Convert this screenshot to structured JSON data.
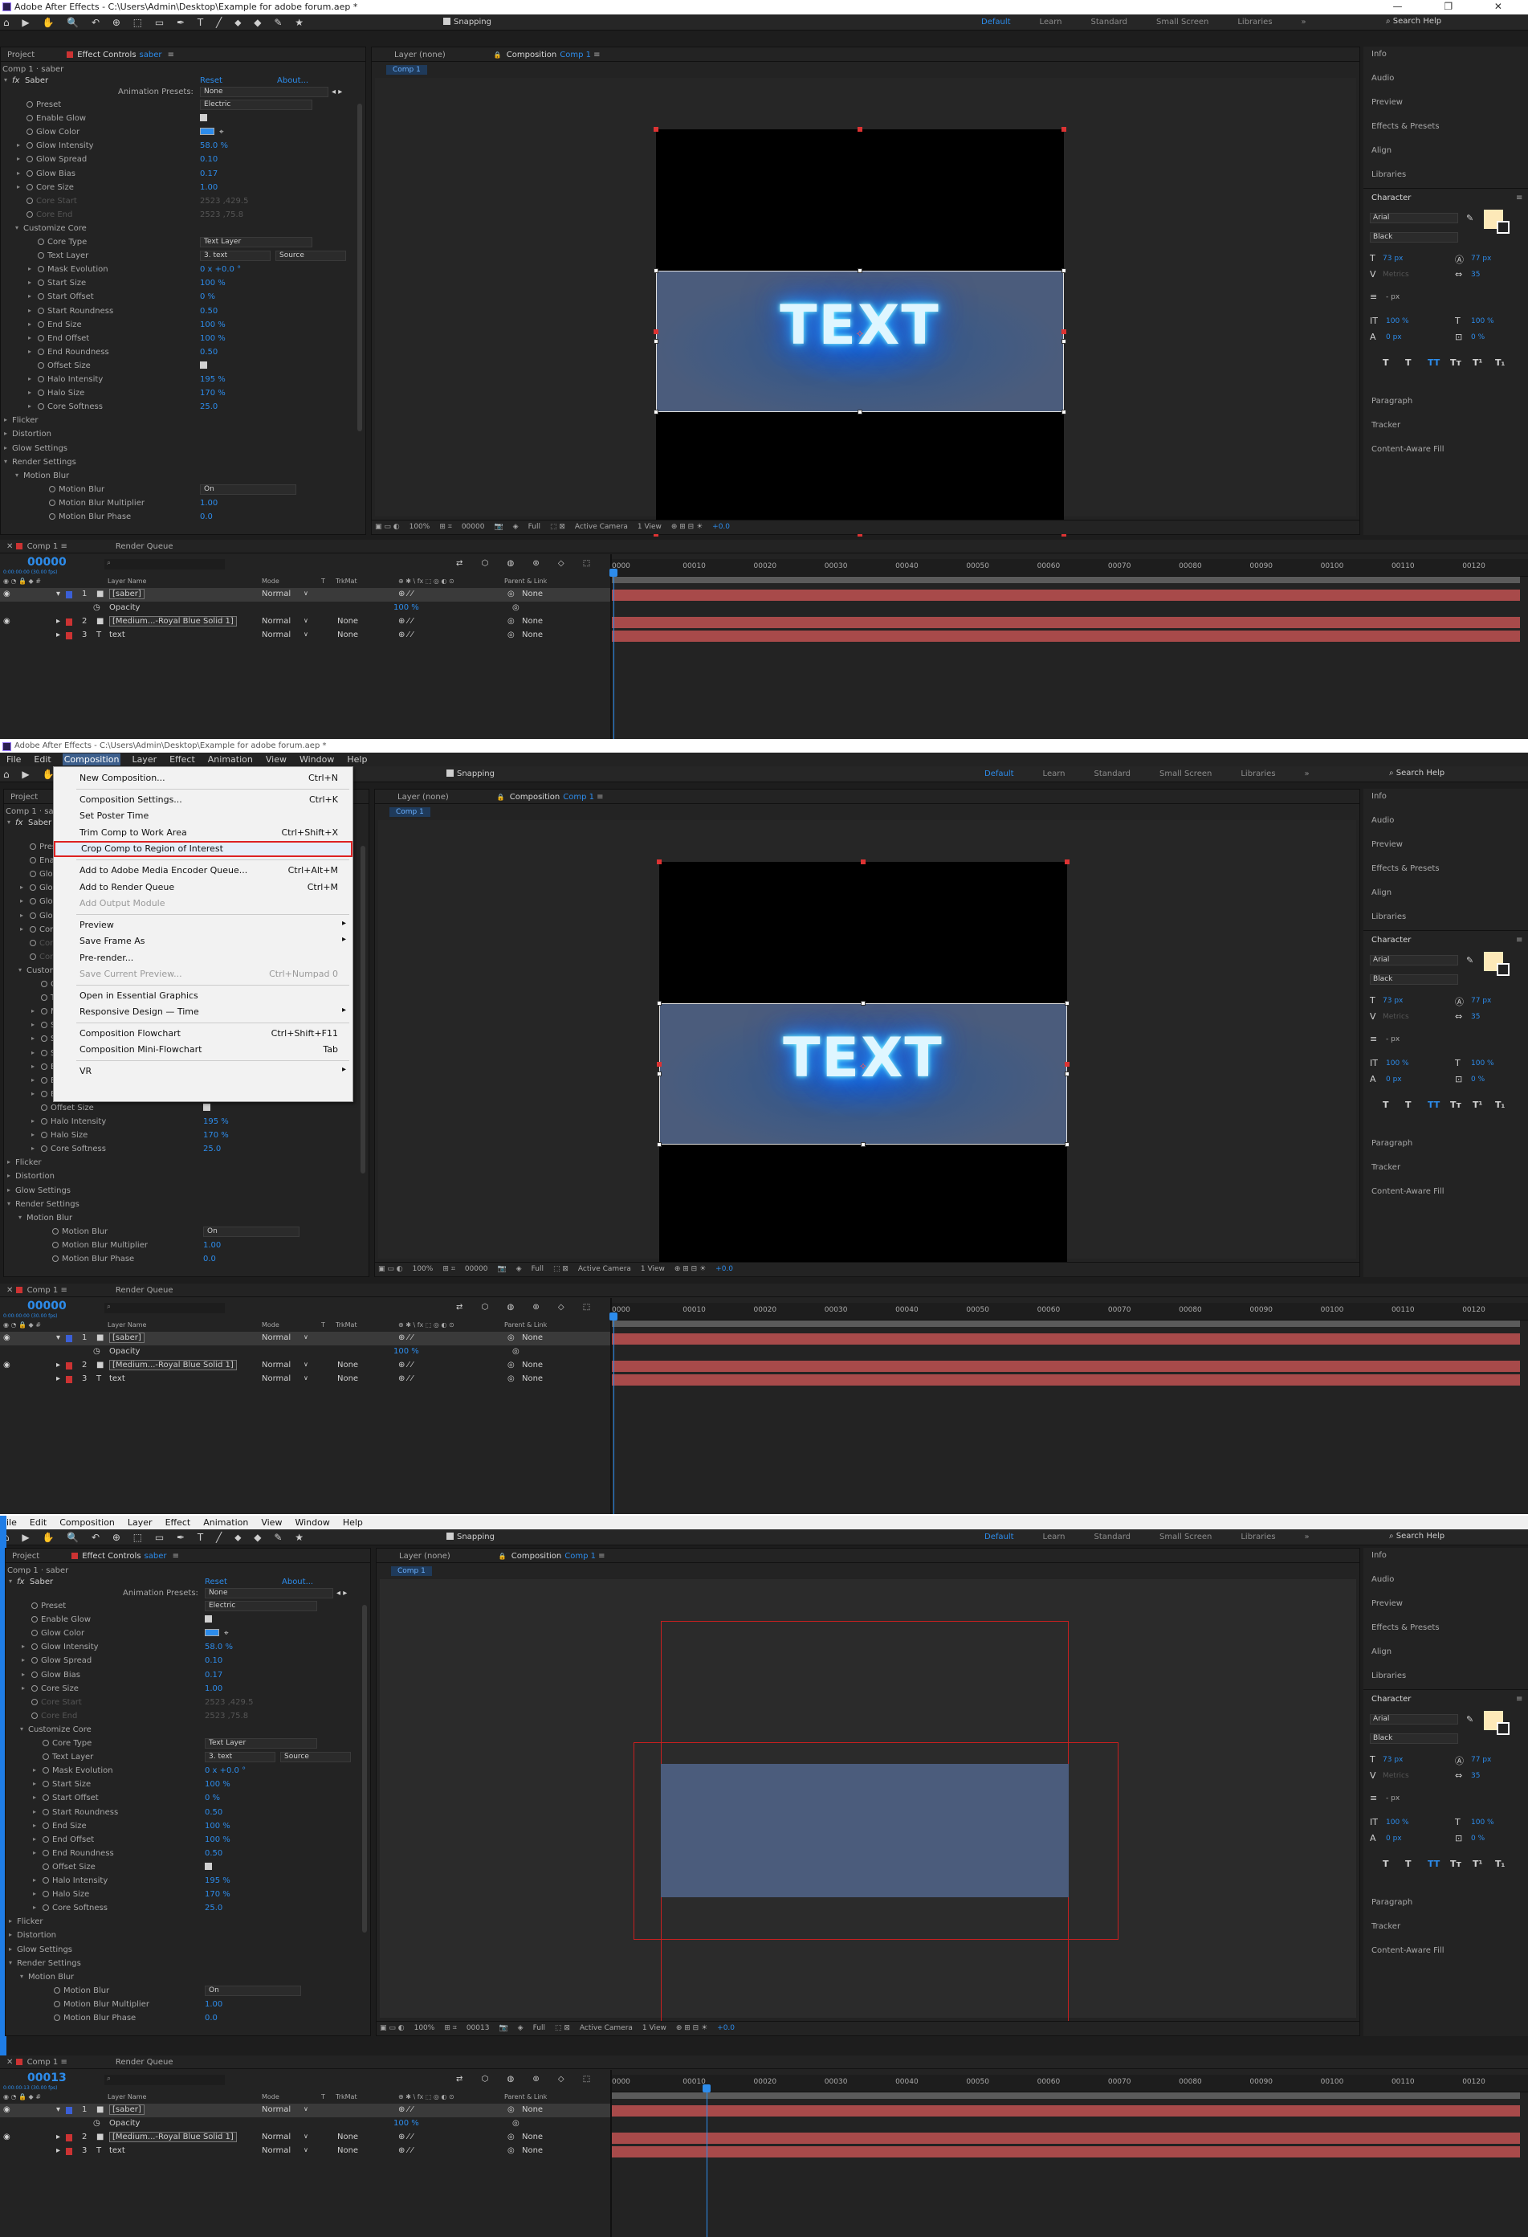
{
  "titlebar": {
    "title": "Adobe After Effects - C:\\Users\\Admin\\Desktop\\Example for adobe forum.aep *",
    "controls": "—  ❐  ✕"
  },
  "menus": [
    "File",
    "Edit",
    "Composition",
    "Layer",
    "Effect",
    "Animation",
    "View",
    "Window",
    "Help"
  ],
  "menus3": [
    "ile",
    "Edit",
    "Composition",
    "Layer",
    "Effect",
    "Animation",
    "View",
    "Window",
    "Help"
  ],
  "toolbar": {
    "tools": "⌂ ▶ ✋ 🔍 ↶ ⊕ ⬚ ▭ ✒ T ╱ ⬥ ◆ ✎ ★",
    "snapping": "Snapping",
    "search_placeholder": "Search Help"
  },
  "workspaces": [
    "Default",
    "Learn",
    "Standard",
    "Small Screen",
    "Libraries"
  ],
  "project_tab": "Project",
  "effect_controls": {
    "tab_prefix": "Effect Controls",
    "layer": "saber",
    "comp_layer": "Comp 1 · saber",
    "fx_name": "Saber",
    "reset": "Reset",
    "about": "About...",
    "presets_label": "Animation Presets:",
    "presets_value": "None"
  },
  "effect_rows": [
    {
      "label": "Preset",
      "kind": "dd",
      "value": "Electric",
      "indent": 1
    },
    {
      "label": "Enable Glow",
      "kind": "cb",
      "indent": 1
    },
    {
      "label": "Glow Color",
      "kind": "sw",
      "indent": 1
    },
    {
      "label": "Glow Intensity",
      "kind": "val",
      "value": "58.0 %",
      "indent": 1,
      "tri": true
    },
    {
      "label": "Glow Spread",
      "kind": "val",
      "value": "0.10",
      "indent": 1,
      "tri": true
    },
    {
      "label": "Glow Bias",
      "kind": "val",
      "value": "0.17",
      "indent": 1,
      "tri": true
    },
    {
      "label": "Core Size",
      "kind": "val",
      "value": "1.00",
      "indent": 1,
      "tri": true
    },
    {
      "label": "Core Start",
      "kind": "val",
      "value": "2523 ,429.5",
      "indent": 1,
      "dim": true
    },
    {
      "label": "Core End",
      "kind": "val",
      "value": "2523 ,75.8",
      "indent": 1,
      "dim": true
    },
    {
      "label": "Customize Core",
      "kind": "group",
      "indent": 1
    },
    {
      "label": "Core Type",
      "kind": "dd",
      "value": "Text Layer",
      "indent": 2
    },
    {
      "label": "Text Layer",
      "kind": "dd2",
      "value": "3. text",
      "value2": "Source",
      "indent": 2
    },
    {
      "label": "Mask Evolution",
      "kind": "val",
      "value": "0 x +0.0 °",
      "indent": 2,
      "tri": true
    },
    {
      "label": "Start Size",
      "kind": "val",
      "value": "100 %",
      "indent": 2,
      "tri": true
    },
    {
      "label": "Start Offset",
      "kind": "val",
      "value": "0 %",
      "indent": 2,
      "tri": true
    },
    {
      "label": "Start Roundness",
      "kind": "val",
      "value": "0.50",
      "indent": 2,
      "tri": true
    },
    {
      "label": "End Size",
      "kind": "val",
      "value": "100 %",
      "indent": 2,
      "tri": true
    },
    {
      "label": "End Offset",
      "kind": "val",
      "value": "100 %",
      "indent": 2,
      "tri": true
    },
    {
      "label": "End Roundness",
      "kind": "val",
      "value": "0.50",
      "indent": 2,
      "tri": true
    },
    {
      "label": "Offset Size",
      "kind": "cb",
      "indent": 2
    },
    {
      "label": "Halo Intensity",
      "kind": "val",
      "value": "195 %",
      "indent": 2,
      "tri": true
    },
    {
      "label": "Halo Size",
      "kind": "val",
      "value": "170 %",
      "indent": 2,
      "tri": true
    },
    {
      "label": "Core Softness",
      "kind": "val",
      "value": "25.0",
      "indent": 2,
      "tri": true
    },
    {
      "label": "Flicker",
      "kind": "group",
      "indent": 0
    },
    {
      "label": "Distortion",
      "kind": "group",
      "indent": 0
    },
    {
      "label": "Glow Settings",
      "kind": "group",
      "indent": 0
    },
    {
      "label": "Render Settings",
      "kind": "group",
      "indent": 0
    },
    {
      "label": "Motion Blur",
      "kind": "group",
      "indent": 1
    },
    {
      "label": "Motion Blur",
      "kind": "dd",
      "value": "On",
      "indent": 3
    },
    {
      "label": "Motion Blur Multiplier",
      "kind": "val",
      "value": "1.00",
      "indent": 3
    },
    {
      "label": "Motion Blur Phase",
      "kind": "val",
      "value": "0.0",
      "indent": 3
    }
  ],
  "comp_panel": {
    "layer_tab": "Layer (none)",
    "comp_tab_prefix": "Composition",
    "comp_name": "Comp 1",
    "crumb": "Comp 1",
    "glow_text": "TEXT"
  },
  "viewer_bar": {
    "zoom": "100%",
    "time1": "00000",
    "time3": "00013",
    "res": "Full",
    "camera": "Active Camera",
    "views": "1 View",
    "exposure": "+0.0"
  },
  "right_panels": [
    "Info",
    "Audio",
    "Preview",
    "Effects & Presets",
    "Align",
    "Libraries"
  ],
  "right_panels2": [
    "Paragraph",
    "Tracker",
    "Content-Aware Fill"
  ],
  "character": {
    "title": "Character",
    "font": "Arial",
    "style": "Black",
    "size": "73 px",
    "leading": "77 px",
    "kerning": "Metrics",
    "tracking": "35",
    "stroke": "- px",
    "vscale": "100 %",
    "hscale": "100 %",
    "baseline": "0 px",
    "tsume": "0 %",
    "fill_color": "#fde9b8",
    "styles": [
      "T",
      "T",
      "TT",
      "Tт",
      "T¹",
      "T₁"
    ]
  },
  "timeline": {
    "tab": "Comp 1",
    "render_queue": "Render Queue",
    "timecode": "00000",
    "timecode3": "00013",
    "sub": "0:00:00:00 (30.00 fps)",
    "sub3": "0:00:00:13 (30.00 fps)",
    "search_placeholder": "⌕",
    "headers": {
      "name": "Layer Name",
      "mode": "Mode",
      "t": "T",
      "trkmat": "TrkMat",
      "parent": "Parent & Link"
    },
    "rows": [
      {
        "num": "1",
        "name": "[saber]",
        "mode": "Normal",
        "trk": "",
        "parent": "None",
        "label": "#3b5fd6",
        "sel": true
      },
      {
        "num": "",
        "name": "Opacity",
        "mode": "",
        "trk": "",
        "parent": "",
        "value": "100 %",
        "prop": true
      },
      {
        "num": "2",
        "name": "[Medium...-Royal Blue Solid 1]",
        "mode": "Normal",
        "trk": "None",
        "parent": "None",
        "label": "#c33",
        "sel": false
      },
      {
        "num": "3",
        "name": "text",
        "mode": "Normal",
        "trk": "None",
        "parent": "None",
        "label": "#c33",
        "sel": false,
        "isText": true
      }
    ],
    "ticks": [
      "0000",
      "00010",
      "00020",
      "00030",
      "00040",
      "00050",
      "00060",
      "00070",
      "00080",
      "00090",
      "00100",
      "00110",
      "00120"
    ]
  },
  "comp_menu": [
    {
      "label": "New Composition...",
      "sc": "Ctrl+N"
    },
    {
      "sep": true
    },
    {
      "label": "Composition Settings...",
      "sc": "Ctrl+K"
    },
    {
      "label": "Set Poster Time",
      "sc": ""
    },
    {
      "label": "Trim Comp to Work Area",
      "sc": "Ctrl+Shift+X"
    },
    {
      "label": "Crop Comp to Region of Interest",
      "sc": "",
      "hl": true
    },
    {
      "sep": true
    },
    {
      "label": "Add to Adobe Media Encoder Queue...",
      "sc": "Ctrl+Alt+M"
    },
    {
      "label": "Add to Render Queue",
      "sc": "Ctrl+M"
    },
    {
      "label": "Add Output Module",
      "sc": "",
      "dis": true
    },
    {
      "sep": true
    },
    {
      "label": "Preview",
      "sc": "",
      "arrow": true
    },
    {
      "label": "Save Frame As",
      "sc": "",
      "arrow": true
    },
    {
      "label": "Pre-render...",
      "sc": ""
    },
    {
      "label": "Save Current Preview...",
      "sc": "Ctrl+Numpad 0",
      "dis": true
    },
    {
      "sep": true
    },
    {
      "label": "Open in Essential Graphics",
      "sc": ""
    },
    {
      "label": "Responsive Design — Time",
      "sc": "",
      "arrow": true
    },
    {
      "sep": true
    },
    {
      "label": "Composition Flowchart",
      "sc": "Ctrl+Shift+F11"
    },
    {
      "label": "Composition Mini-Flowchart",
      "sc": "Tab"
    },
    {
      "sep": true
    },
    {
      "label": "VR",
      "sc": "",
      "arrow": true
    }
  ]
}
